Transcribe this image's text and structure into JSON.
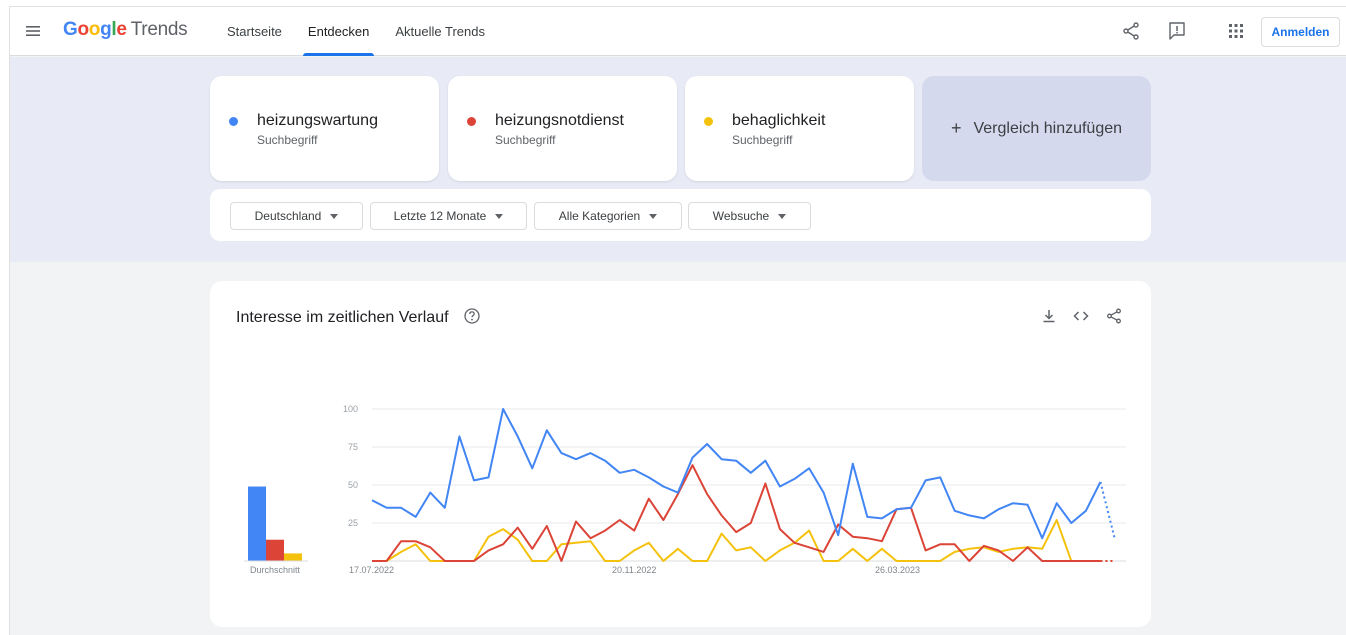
{
  "header": {
    "brand": "Google",
    "product": "Trends",
    "tabs": [
      {
        "label": "Startseite",
        "active": false
      },
      {
        "label": "Entdecken",
        "active": true
      },
      {
        "label": "Aktuelle Trends",
        "active": false
      }
    ],
    "icons": [
      "share-icon",
      "feedback-icon",
      "apps-grid-icon"
    ],
    "signin_label": "Anmelden"
  },
  "terms": [
    {
      "name": "heizungswartung",
      "subtitle": "Suchbegriff",
      "color": "#4285f4"
    },
    {
      "name": "heizungsnotdienst",
      "subtitle": "Suchbegriff",
      "color": "#db4437"
    },
    {
      "name": "behaglichkeit",
      "subtitle": "Suchbegriff",
      "color": "#f4c20d"
    }
  ],
  "add_compare": {
    "plus": "+",
    "label": "Vergleich hinzufügen"
  },
  "filters": [
    {
      "label": "Deutschland"
    },
    {
      "label": "Letzte 12 Monate"
    },
    {
      "label": "Alle Kategorien"
    },
    {
      "label": "Websuche"
    }
  ],
  "chart": {
    "title": "Interesse im zeitlichen Verlauf",
    "icons": [
      "help-icon",
      "download-icon",
      "embed-icon",
      "share-icon"
    ]
  },
  "chart_data": {
    "type": "line",
    "ylim": [
      0,
      100
    ],
    "yticks": [
      "25",
      "50",
      "75",
      "100"
    ],
    "x_tick_labels": [
      "17.07.2022",
      "20.11.2022",
      "26.03.2023"
    ],
    "grid": true,
    "average_label": "Durchschnitt",
    "averages": [
      49,
      14,
      5
    ],
    "partial_last_point": true,
    "series": [
      {
        "name": "heizungswartung",
        "color": "#4285f4",
        "values": [
          40,
          35,
          35,
          29,
          45,
          35,
          82,
          53,
          55,
          100,
          82,
          61,
          86,
          71,
          67,
          71,
          66,
          58,
          60,
          55,
          49,
          45,
          68,
          77,
          67,
          66,
          58,
          66,
          49,
          54,
          61,
          45,
          17,
          64,
          29,
          28,
          34,
          35,
          53,
          55,
          33,
          30,
          28,
          34,
          38,
          37,
          15,
          38,
          25,
          33,
          52,
          14
        ]
      },
      {
        "name": "heizungsnotdienst",
        "color": "#db4437",
        "values": [
          0,
          0,
          13,
          13,
          9,
          0,
          0,
          0,
          7,
          11,
          22,
          8,
          23,
          0,
          26,
          15,
          20,
          27,
          20,
          41,
          27,
          44,
          63,
          44,
          30,
          19,
          25,
          51,
          21,
          12,
          9,
          6,
          24,
          16,
          15,
          13,
          34,
          35,
          7,
          11,
          11,
          0,
          10,
          7,
          0,
          9,
          0,
          0,
          0,
          0,
          0,
          0
        ]
      },
      {
        "name": "behaglichkeit",
        "color": "#f4c20d",
        "values": [
          0,
          0,
          6,
          11,
          0,
          0,
          0,
          0,
          16,
          21,
          14,
          0,
          0,
          11,
          12,
          13,
          0,
          0,
          7,
          12,
          0,
          8,
          0,
          0,
          18,
          7,
          9,
          0,
          7,
          12,
          20,
          0,
          0,
          8,
          0,
          8,
          0,
          0,
          0,
          0,
          6,
          8,
          9,
          6,
          8,
          9,
          8,
          27,
          0,
          0,
          0,
          0
        ]
      }
    ]
  }
}
